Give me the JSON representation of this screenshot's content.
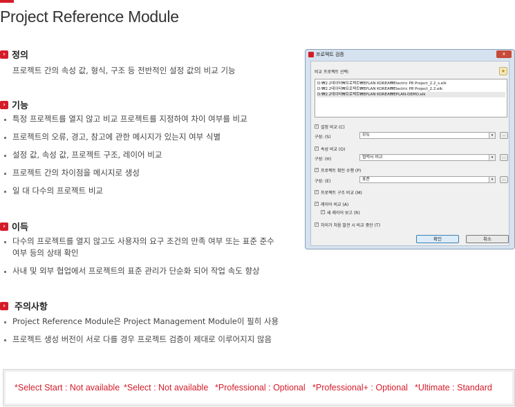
{
  "page": {
    "title": "Project Reference Module",
    "accent_color": "#d51c29"
  },
  "sections": {
    "definition": {
      "label": "정의",
      "icon": "chevron-right-icon",
      "text": "프로젝트 간의 속성 값, 형식, 구조 등 전반적인 설정 값의 비교 기능"
    },
    "features": {
      "label": "기능",
      "icon": "chevron-right-icon",
      "items": [
        "특정 프로젝트를 열지 않고 비교 프로젝트를 지정하여 차이 여부를 비교",
        "프로젝트의 오류, 경고, 참고에 관한 메시지가 있는지 여부 식별",
        "설정 값, 속성 값, 프로젝트 구조, 레이어 비교",
        "프로젝트 간의 차이점을 메시지로 생성",
        "일 대 다수의 프로젝트 비교"
      ]
    },
    "benefits": {
      "label": "이득",
      "icon": "chevron-right-icon",
      "items": [
        "다수의 프로젝트를 열지 않고도 사용자의 요구 조건의 만족 여부 또는 표준 준수",
        "여부 등의 상태 확인",
        "사내 및 외부 협업에서 프로젝트의 표준 관리가 단순화 되어 작업 속도 향상"
      ]
    },
    "notes": {
      "label": "주의사항",
      "icon": "chevron-right-icon",
      "items": [
        "Project Reference Module은 Project Management Module이 필히 사용",
        "프로젝트 생성 버전이 서로 다를 경우 프로젝트 검증이 제대로 이루어지지 않음"
      ]
    }
  },
  "dialog": {
    "title": "프로젝트 검증",
    "close_label": "x",
    "compare_label": "비교 프로젝트 선택:",
    "star_icon": "star-icon",
    "projects": [
      "D:₩2.2데이터₩프로젝트₩EPLAN KOREA₩Electric P8 Project_2.2_s.elk",
      "D:₩2.2데이터₩프로젝트₩EPLAN KOREA₩Electric P8 Project_2.2.elk",
      "D:₩2.2데이터₩프로젝트₩EPLAN KOREA₩EPLAN-DEMO.elk"
    ],
    "settings_check": "설정 비교 (C)",
    "settings_config_label": "구성: (S)",
    "settings_config_value": "모두",
    "props_check": "속성 비교 (O)",
    "props_config_label": "구성: (H)",
    "props_config_value": "협력사 비교",
    "check_check": "프로젝트 확인 수행 (P)",
    "check_config_label": "구성: (E)",
    "check_config_value": "표준",
    "structure_check": "프로젝트 구조 비교 (M)",
    "layer_check": "레이어 비교 (A)",
    "new_layer_check": "새 레이어 보고 (R)",
    "stop_check": "차이가 처음 발견 시 비교 중단 (T)",
    "ok_label": "확인",
    "cancel_label": "취소",
    "dots_label": "...",
    "check_mark": "✓",
    "arrow": "▾"
  },
  "editions": [
    "*Select Start : Not available",
    "*Select : Not available",
    "*Professional : Optional",
    "*Professional+ : Optional",
    "*Ultimate : Standard"
  ]
}
